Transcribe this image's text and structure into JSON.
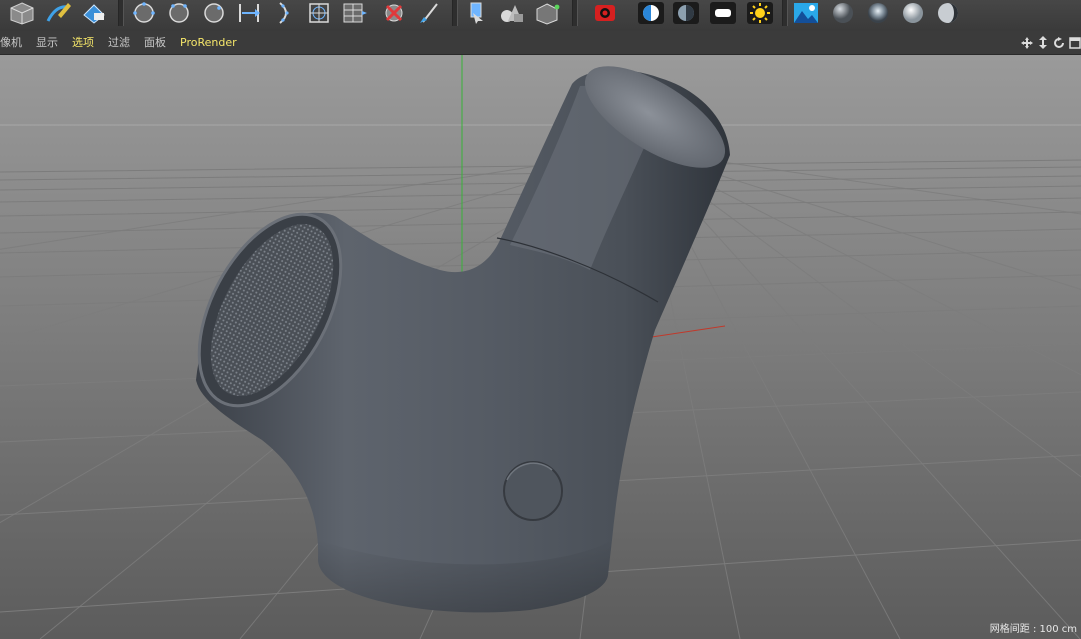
{
  "toolbar": {
    "buttons": [
      {
        "icon": "cube-icon"
      },
      {
        "icon": "pen-spline-icon"
      },
      {
        "icon": "eraser-icon"
      },
      {
        "icon": "subdivision-icon"
      },
      {
        "icon": "extrude-icon"
      },
      {
        "icon": "boole-icon"
      },
      {
        "icon": "symmetry-icon"
      },
      {
        "icon": "array-icon"
      },
      {
        "icon": "spline-wrap-icon"
      },
      {
        "icon": "ffd-icon"
      },
      {
        "icon": "bend-deformer-icon"
      },
      {
        "icon": "delete-deformer-icon"
      },
      {
        "icon": "paint-brush-icon"
      },
      {
        "icon": "select-tool-icon"
      },
      {
        "icon": "primitive-shapes-icon"
      },
      {
        "icon": "polygon-object-icon"
      },
      {
        "icon": "camera-icon"
      },
      {
        "icon": "light-half-icon"
      },
      {
        "icon": "light-dark-icon"
      },
      {
        "icon": "area-light-icon"
      },
      {
        "icon": "sun-icon"
      },
      {
        "icon": "environment-icon"
      },
      {
        "icon": "sky-sphere-icon"
      },
      {
        "icon": "floor-sphere-icon"
      },
      {
        "icon": "background-sphere-icon"
      },
      {
        "icon": "stage-sphere-icon"
      }
    ]
  },
  "viewport_menu": {
    "items": [
      {
        "label": "像机",
        "state": "normal"
      },
      {
        "label": "显示",
        "state": "normal"
      },
      {
        "label": "选项",
        "state": "active"
      },
      {
        "label": "过滤",
        "state": "normal"
      },
      {
        "label": "面板",
        "state": "normal"
      },
      {
        "label": "ProRender",
        "state": "plugin"
      }
    ],
    "nav_icons": [
      "move-view-icon",
      "zoom-view-icon",
      "rotate-view-icon",
      "maximize-view-icon"
    ]
  },
  "viewport": {
    "grid_spacing_label": "网格间距 : 100 cm",
    "axis_colors": {
      "x": "#c0392b",
      "y": "#38b338"
    },
    "object_color": "#565c66"
  }
}
